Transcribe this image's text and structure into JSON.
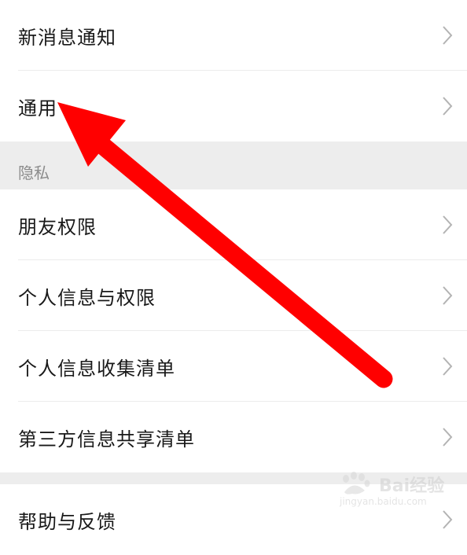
{
  "settings": {
    "group1": [
      {
        "label": "新消息通知"
      },
      {
        "label": "通用"
      }
    ],
    "privacy_section": {
      "title": "隐私",
      "items": [
        {
          "label": "朋友权限"
        },
        {
          "label": "个人信息与权限"
        },
        {
          "label": "个人信息收集清单"
        },
        {
          "label": "第三方信息共享清单"
        }
      ]
    },
    "group3": [
      {
        "label": "帮助与反馈"
      }
    ]
  },
  "overlay": {
    "arrow_color": "#ff0000"
  },
  "watermark": {
    "brand": "Bai经验",
    "url": "jingyan.baidu.com"
  },
  "icons": {
    "row_chevron": "chevron-right-icon"
  }
}
